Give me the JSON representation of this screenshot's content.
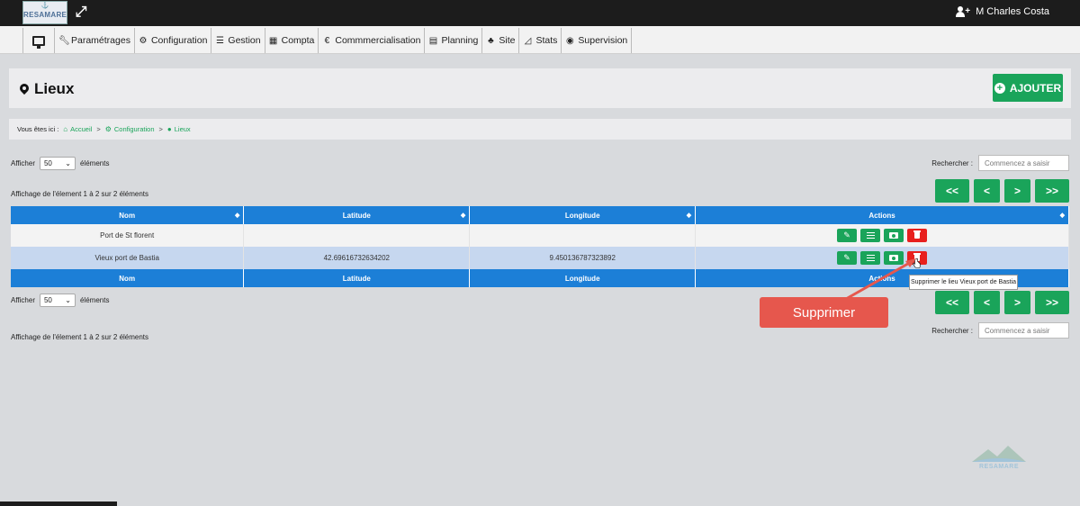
{
  "topbar": {
    "logo_text": "RESAMARE",
    "logo_glyph": "⚓",
    "user_name": "M Charles Costa"
  },
  "nav": {
    "items": [
      {
        "label": "Paramétrages",
        "icon": "wrench-icon"
      },
      {
        "label": "Configuration",
        "icon": "cogs-icon"
      },
      {
        "label": "Gestion",
        "icon": "gestion-icon"
      },
      {
        "label": "Compta",
        "icon": "calculator-icon"
      },
      {
        "label": "Commmercialisation",
        "icon": "euro-icon"
      },
      {
        "label": "Planning",
        "icon": "calendar-icon"
      },
      {
        "label": "Site",
        "icon": "sitemap-icon"
      },
      {
        "label": "Stats",
        "icon": "chart-icon"
      },
      {
        "label": "Supervision",
        "icon": "eye-icon"
      }
    ]
  },
  "page": {
    "title": "Lieux",
    "add_label": "AJOUTER"
  },
  "breadcrumb": {
    "prefix": "Vous êtes ici :",
    "home": "Accueil",
    "section": "Configuration",
    "current": "Lieux",
    "separator": ">"
  },
  "table_controls": {
    "show_label": "Afficher",
    "page_size": "50",
    "elements_label": "éléments",
    "search_label": "Rechercher :",
    "search_placeholder": "Commencez a saisir",
    "info": "Affichage de l'élement 1 à 2 sur 2 éléments",
    "pager": {
      "first": "<<",
      "prev": "<",
      "next": ">",
      "last": ">>"
    }
  },
  "table": {
    "columns": [
      "Nom",
      "Latitude",
      "Longitude",
      "Actions"
    ],
    "rows": [
      {
        "nom": "Port de St florent",
        "latitude": "",
        "longitude": ""
      },
      {
        "nom": "Vieux port de Bastia",
        "latitude": "42.69616732634202",
        "longitude": "9.450136787323892"
      }
    ]
  },
  "tooltip": "Supprimer le lieu Vieux port de Bastia",
  "callout": "Supprimer",
  "watermark": "RESAMARE"
}
